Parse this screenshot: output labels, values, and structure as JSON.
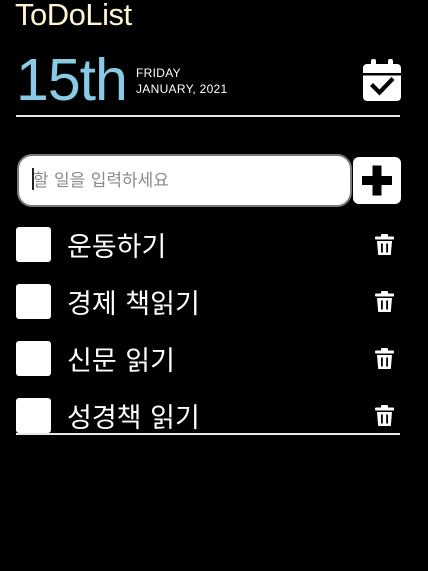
{
  "app": {
    "title": "ToDoList"
  },
  "date": {
    "day": "15th",
    "weekday": "FRIDAY",
    "month_year": "JANUARY, 2021"
  },
  "input": {
    "placeholder": "할 일을 입력하세요",
    "value": ""
  },
  "icons": {
    "calendar": "calendar-check-icon",
    "add": "plus-icon",
    "delete": "trash-icon"
  },
  "colors": {
    "background": "#000000",
    "title": "#fff4ce",
    "date": "#87cbe6",
    "text": "#ffffff",
    "divider": "#e8e8e8"
  },
  "todos": [
    {
      "text": "운동하기",
      "done": false
    },
    {
      "text": "경제 책읽기",
      "done": false
    },
    {
      "text": "신문 읽기",
      "done": false
    },
    {
      "text": "성경책 읽기",
      "done": false
    }
  ]
}
